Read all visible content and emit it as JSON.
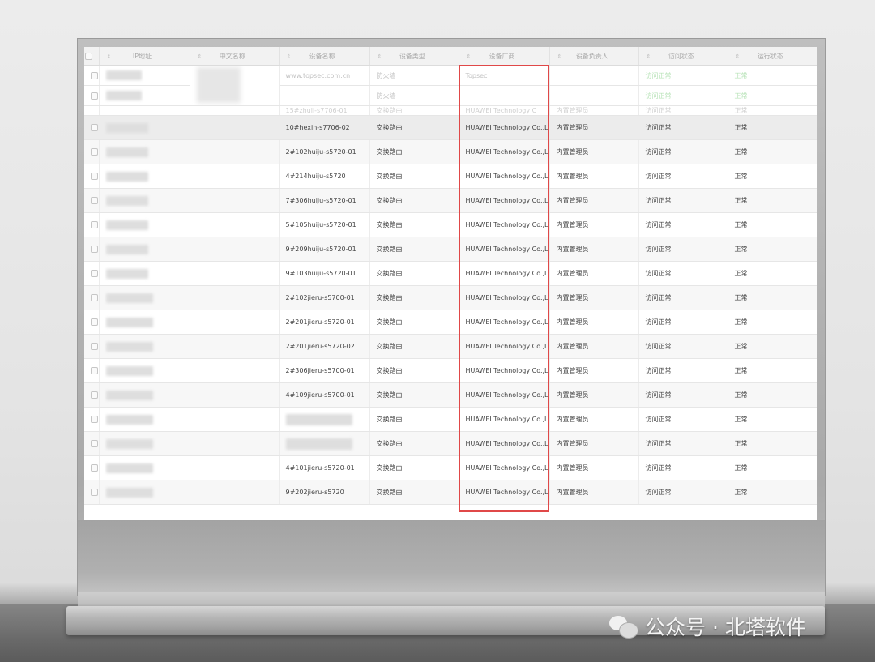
{
  "table": {
    "headers": [
      "IP地址",
      "中文名称",
      "设备名称",
      "设备类型",
      "设备厂商",
      "设备负责人",
      "访问状态",
      "运行状态"
    ],
    "top_rows": [
      {
        "device_name": "www.topsec.com.cn",
        "device_type": "防火墙",
        "vendor": "Topsec",
        "owner": "",
        "access": "访问正常",
        "run": "正常"
      },
      {
        "device_name": "",
        "device_type": "防火墙",
        "vendor": "",
        "owner": "",
        "access": "访问正常",
        "run": "正常"
      }
    ],
    "partial_row": {
      "device_name": "15#zhuli-s7706-01",
      "device_type": "交换路由",
      "vendor": "HUAWEI Technology C",
      "owner": "内置管理员",
      "access": "访问正常",
      "run": "正常"
    },
    "rows": [
      {
        "device_name": "10#hexin-s7706-02",
        "device_type": "交换路由",
        "vendor": "HUAWEI Technology Co.,Ltd",
        "owner": "内置管理员",
        "access": "访问正常",
        "run": "正常"
      },
      {
        "device_name": "2#102huiju-s5720-01",
        "device_type": "交换路由",
        "vendor": "HUAWEI Technology Co.,Ltd",
        "owner": "内置管理员",
        "access": "访问正常",
        "run": "正常"
      },
      {
        "device_name": "4#214huiju-s5720",
        "device_type": "交换路由",
        "vendor": "HUAWEI Technology Co.,Ltd",
        "owner": "内置管理员",
        "access": "访问正常",
        "run": "正常"
      },
      {
        "device_name": "7#306huiju-s5720-01",
        "device_type": "交换路由",
        "vendor": "HUAWEI Technology Co.,Ltd",
        "owner": "内置管理员",
        "access": "访问正常",
        "run": "正常"
      },
      {
        "device_name": "5#105huiju-s5720-01",
        "device_type": "交换路由",
        "vendor": "HUAWEI Technology Co.,Ltd",
        "owner": "内置管理员",
        "access": "访问正常",
        "run": "正常"
      },
      {
        "device_name": "9#209huiju-s5720-01",
        "device_type": "交换路由",
        "vendor": "HUAWEI Technology Co.,Ltd",
        "owner": "内置管理员",
        "access": "访问正常",
        "run": "正常"
      },
      {
        "device_name": "9#103huiju-s5720-01",
        "device_type": "交换路由",
        "vendor": "HUAWEI Technology Co.,Ltd",
        "owner": "内置管理员",
        "access": "访问正常",
        "run": "正常"
      },
      {
        "device_name": "2#102jieru-s5700-01",
        "device_type": "交换路由",
        "vendor": "HUAWEI Technology Co.,Ltd",
        "owner": "内置管理员",
        "access": "访问正常",
        "run": "正常"
      },
      {
        "device_name": "2#201jieru-s5720-01",
        "device_type": "交换路由",
        "vendor": "HUAWEI Technology Co.,Ltd",
        "owner": "内置管理员",
        "access": "访问正常",
        "run": "正常"
      },
      {
        "device_name": "2#201jieru-s5720-02",
        "device_type": "交换路由",
        "vendor": "HUAWEI Technology Co.,Ltd",
        "owner": "内置管理员",
        "access": "访问正常",
        "run": "正常"
      },
      {
        "device_name": "2#306jieru-s5700-01",
        "device_type": "交换路由",
        "vendor": "HUAWEI Technology Co.,Ltd",
        "owner": "内置管理员",
        "access": "访问正常",
        "run": "正常"
      },
      {
        "device_name": "4#109jieru-s5700-01",
        "device_type": "交换路由",
        "vendor": "HUAWEI Technology Co.,Ltd",
        "owner": "内置管理员",
        "access": "访问正常",
        "run": "正常"
      },
      {
        "device_name": "",
        "device_type": "交换路由",
        "vendor": "HUAWEI Technology Co.,Ltd",
        "owner": "内置管理员",
        "access": "访问正常",
        "run": "正常"
      },
      {
        "device_name": "",
        "device_type": "交换路由",
        "vendor": "HUAWEI Technology Co.,Ltd",
        "owner": "内置管理员",
        "access": "访问正常",
        "run": "正常"
      },
      {
        "device_name": "4#101jieru-s5720-01",
        "device_type": "交换路由",
        "vendor": "HUAWEI Technology Co.,Ltd",
        "owner": "内置管理员",
        "access": "访问正常",
        "run": "正常"
      },
      {
        "device_name": "9#202jieru-s5720",
        "device_type": "交换路由",
        "vendor": "HUAWEI Technology Co.,Ltd",
        "owner": "内置管理员",
        "access": "访问正常",
        "run": "正常"
      }
    ]
  },
  "watermark": {
    "text": "公众号 · 北塔软件"
  },
  "colors": {
    "highlight_box": "#e04848",
    "status_ok": "#2eae2e"
  }
}
